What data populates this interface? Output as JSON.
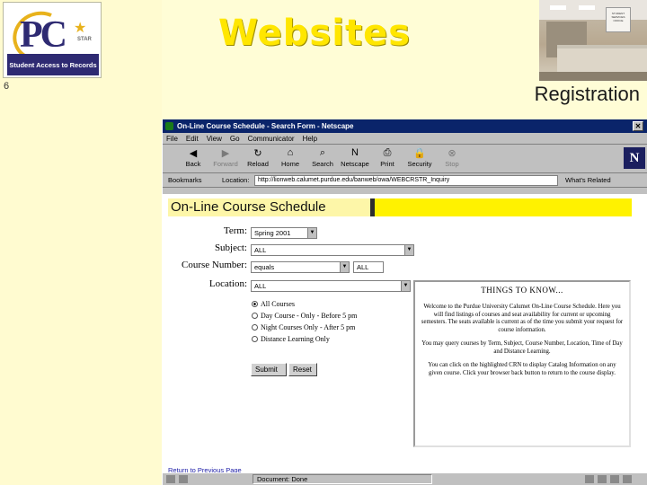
{
  "slide": {
    "title": "Websites",
    "subtitle": "Registration",
    "slide_number": "6",
    "logo": {
      "letters": "PC",
      "star_text": "STAR",
      "tagline": "Student Access to Records"
    },
    "photo_sign": "STUDENT SERVICES OFFICE"
  },
  "browser": {
    "window_title": "On-Line Course Schedule - Search Form - Netscape",
    "menu": [
      "File",
      "Edit",
      "View",
      "Go",
      "Communicator",
      "Help"
    ],
    "toolbar": [
      {
        "label": "Back",
        "icon": "back-arrow-icon",
        "glyph": "◀"
      },
      {
        "label": "Forward",
        "icon": "forward-arrow-icon",
        "glyph": "▶"
      },
      {
        "label": "Reload",
        "icon": "reload-icon",
        "glyph": "↻"
      },
      {
        "label": "Home",
        "icon": "home-icon",
        "glyph": "⌂"
      },
      {
        "label": "Search",
        "icon": "search-icon",
        "glyph": "⌕"
      },
      {
        "label": "Netscape",
        "icon": "netscape-icon",
        "glyph": "N"
      },
      {
        "label": "Print",
        "icon": "print-icon",
        "glyph": "⎙"
      },
      {
        "label": "Security",
        "icon": "security-lock-icon",
        "glyph": "🔒"
      },
      {
        "label": "Stop",
        "icon": "stop-icon",
        "glyph": "⊗"
      }
    ],
    "bookmarks_label": "Bookmarks",
    "location_label": "Location:",
    "url": "http://lionweb.calumet.purdue.edu/banweb/owa/WEBCRSTR_Inquiry",
    "related_label": "What's Related",
    "status_text": "Document: Done"
  },
  "page": {
    "banner": "On-Line Course Schedule",
    "form": {
      "term_label": "Term:",
      "term_value": "Spring 2001",
      "subject_label": "Subject:",
      "subject_value": "ALL",
      "course_number_label": "Course Number:",
      "course_number_operator": "equals",
      "course_number_value": "ALL",
      "location_label": "Location:",
      "location_value": "ALL",
      "radios": [
        {
          "label": "All Courses",
          "checked": true
        },
        {
          "label": "Day Course - Only - Before 5 pm",
          "checked": false
        },
        {
          "label": "Night Courses Only - After 5 pm",
          "checked": false
        },
        {
          "label": "Distance Learning Only",
          "checked": false
        }
      ],
      "submit_label": "Submit",
      "reset_label": "Reset"
    },
    "things_to_know": {
      "heading": "THINGS TO KNOW...",
      "p1": "Welcome to the Purdue University Calumet On-Line Course Schedule. Here you will find listings of courses and seat availability for current or upcoming semesters. The seats available is current as of the time you submit your request for course information.",
      "p2": "You may query courses by Term, Subject, Course Number, Location, Time of Day and Distance Learning.",
      "p3": "You can click on the highlighted CRN to display Catalog Information on any given course. Click your browser back button to return to the course display."
    },
    "prev_link": "Return to Previous Page"
  }
}
